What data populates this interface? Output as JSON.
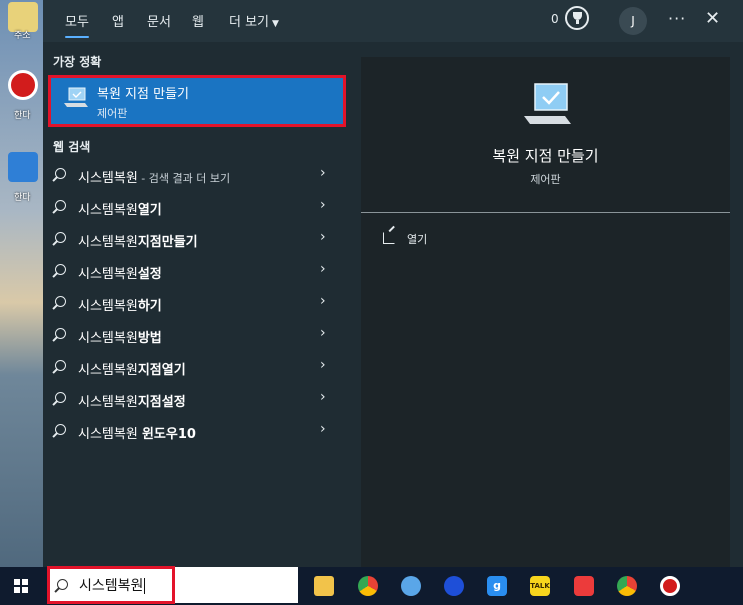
{
  "tabs": [
    "모두",
    "앱",
    "문서",
    "웹",
    "더 보기"
  ],
  "header": {
    "points": "0",
    "avatar_initial": "J",
    "more": "···",
    "close": "✕"
  },
  "desktop": {
    "labels": [
      "주소",
      "한다",
      "한다"
    ]
  },
  "best_match": {
    "section_label": "가장 정확",
    "title": "복원 지점 만들기",
    "subtitle": "제어판"
  },
  "web_search": {
    "section_label": "웹 검색",
    "items": [
      {
        "prefix": "시스템복원",
        "bold": "",
        "suffix": " - 검색 결과 더 보기"
      },
      {
        "prefix": "시스템복원",
        "bold": "열기",
        "suffix": ""
      },
      {
        "prefix": "시스템복원",
        "bold": "지점만들기",
        "suffix": ""
      },
      {
        "prefix": "시스템복원",
        "bold": "설정",
        "suffix": ""
      },
      {
        "prefix": "시스템복원",
        "bold": "하기",
        "suffix": ""
      },
      {
        "prefix": "시스템복원",
        "bold": "방법",
        "suffix": ""
      },
      {
        "prefix": "시스템복원",
        "bold": "지점열기",
        "suffix": ""
      },
      {
        "prefix": "시스템복원",
        "bold": "지점설정",
        "suffix": ""
      },
      {
        "prefix": "시스템복원 ",
        "bold": "윈도우10",
        "suffix": ""
      }
    ]
  },
  "detail": {
    "title": "복원 지점 만들기",
    "subtitle": "제어판",
    "open_label": "열기"
  },
  "taskbar": {
    "search_query": "시스템복원"
  },
  "colors": {
    "accent": "#1a74c2",
    "highlight": "#e3132a",
    "panel": "#1f2c33"
  }
}
